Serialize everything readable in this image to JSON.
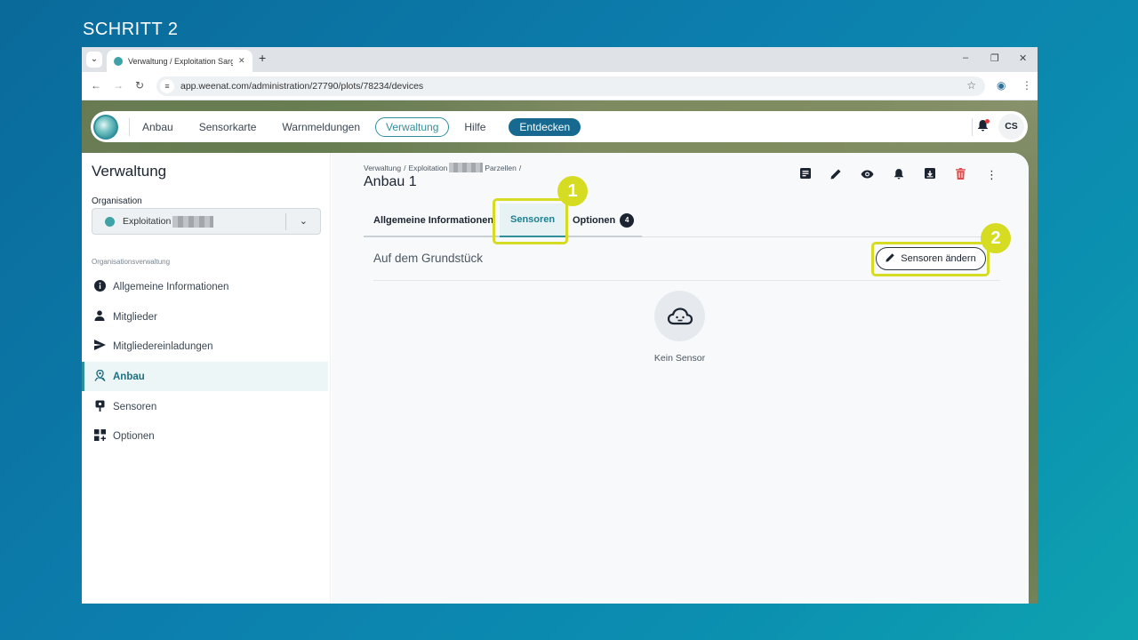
{
  "step": {
    "title": "SCHRITT 2"
  },
  "browser": {
    "tab_title": "Verwaltung / Exploitation Sargi",
    "url": "app.weenat.com/administration/27790/plots/78234/devices"
  },
  "topnav": {
    "items": [
      {
        "label": "Anbau"
      },
      {
        "label": "Sensorkarte"
      },
      {
        "label": "Warnmeldungen"
      },
      {
        "label": "Verwaltung",
        "active": true
      },
      {
        "label": "Hilfe"
      }
    ],
    "discover_label": "Entdecken",
    "avatar_initials": "CS"
  },
  "sidebar": {
    "title": "Verwaltung",
    "org_label": "Organisation",
    "org_name": "Exploitation",
    "section_label": "Organisationsverwaltung",
    "items": [
      {
        "label": "Allgemeine Informationen",
        "icon": "info-icon"
      },
      {
        "label": "Mitglieder",
        "icon": "person-icon"
      },
      {
        "label": "Mitgliedereinladungen",
        "icon": "send-icon"
      },
      {
        "label": "Anbau",
        "icon": "plot-pin-icon",
        "active": true
      },
      {
        "label": "Sensoren",
        "icon": "sensor-icon"
      },
      {
        "label": "Optionen",
        "icon": "options-grid-icon"
      }
    ]
  },
  "main": {
    "breadcrumb": {
      "part1": "Verwaltung",
      "sep1": "/",
      "part2": "Exploitation",
      "part3": "Parzellen",
      "sep2": "/"
    },
    "title": "Anbau 1",
    "tabs": [
      {
        "label": "Allgemeine Informationen"
      },
      {
        "label": "Sensoren",
        "active": true
      },
      {
        "label": "Optionen",
        "badge": "4"
      }
    ],
    "section_title": "Auf dem Grundstück",
    "edit_button": "Sensoren ändern",
    "empty_text": "Kein Sensor"
  },
  "annotations": {
    "marker1": "1",
    "marker2": "2",
    "highlight_color": "#d6dc22"
  },
  "colors": {
    "accent": "#2f8f9a",
    "discover": "#17698f",
    "delete": "#e04a4a"
  }
}
